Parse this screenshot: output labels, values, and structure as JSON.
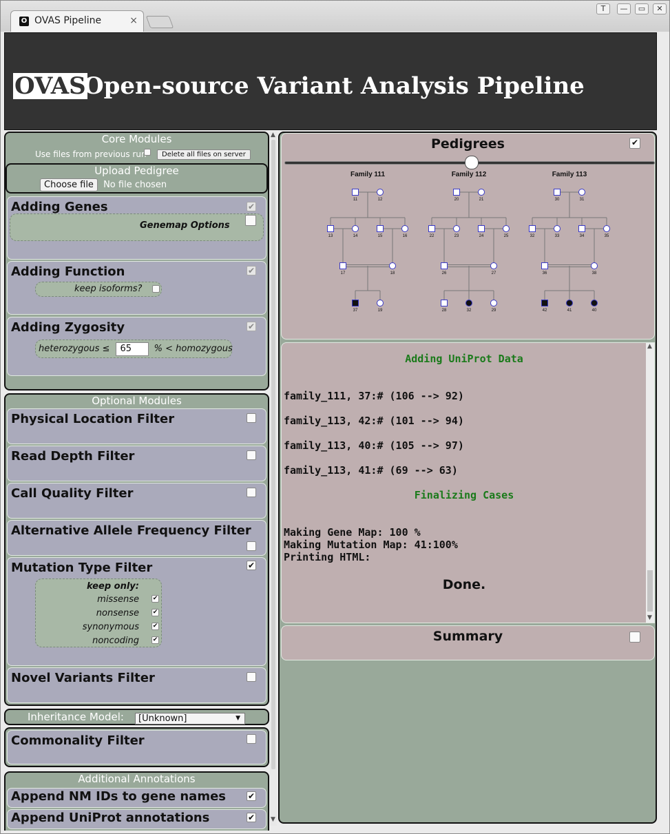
{
  "window": {
    "tab_title": "OVAS Pipeline",
    "tab_close": "×",
    "tab_icon_glyph": "O",
    "controls": [
      "T",
      "—",
      "▭",
      "✕"
    ]
  },
  "header": {
    "logo": "OVAS",
    "title": "Open-source Variant Analysis Pipeline"
  },
  "core": {
    "title": "Core Modules",
    "use_prev_label": "Use files from previous run",
    "delete_button": "Delete all files on server",
    "upload": {
      "title": "Upload Pedigree",
      "choose_button": "Choose file",
      "no_file": "No file chosen"
    },
    "adding_genes": {
      "title": "Adding Genes",
      "genemap_label": "Genemap Options"
    },
    "adding_function": {
      "title": "Adding Function",
      "isoforms_label": "keep isoforms?"
    },
    "adding_zygosity": {
      "title": "Adding Zygosity",
      "het_label": "heterozygous ≤",
      "het_value": "65",
      "hom_label": "% < homozygous"
    }
  },
  "optional": {
    "title": "Optional Modules",
    "physical_location": "Physical Location Filter",
    "read_depth": "Read Depth Filter",
    "call_quality": "Call Quality Filter",
    "alt_allele": "Alternative Allele Frequency Filter",
    "mutation_type": {
      "title": "Mutation Type Filter",
      "keep_only": "keep only:",
      "options": [
        "missense",
        "nonsense",
        "synonymous",
        "noncoding"
      ]
    },
    "novel_variants": "Novel Variants Filter"
  },
  "inheritance": {
    "label": "Inheritance Model:",
    "value": "[Unknown]"
  },
  "commonality": {
    "title": "Commonality Filter"
  },
  "additional": {
    "title": "Additional Annotations",
    "nm_ids": "Append NM IDs to gene names",
    "uniprot": "Append UniProt annotations"
  },
  "pedigrees": {
    "title": "Pedigrees",
    "families": [
      {
        "name": "Family 111",
        "ids": [
          "11",
          "12",
          "13",
          "14",
          "15",
          "16",
          "17",
          "18",
          "37",
          "19"
        ]
      },
      {
        "name": "Family 112",
        "ids": [
          "20",
          "21",
          "22",
          "23",
          "24",
          "25",
          "26",
          "27",
          "28",
          "32",
          "29"
        ]
      },
      {
        "name": "Family 113",
        "ids": [
          "30",
          "31",
          "32",
          "33",
          "34",
          "35",
          "36",
          "38",
          "42",
          "41",
          "40"
        ]
      }
    ]
  },
  "log": {
    "heading1": "Adding UniProt Data",
    "lines1": [
      "family_111, 37:# (106 --> 92)",
      "family_113, 42:# (101 --> 94)",
      "family_113, 40:# (105 --> 97)",
      "family_113, 41:# (69 --> 63)"
    ],
    "heading2": "Finalizing Cases",
    "lines2": [
      "Making Gene Map: 100 %",
      "Making Mutation Map: 41:100%",
      "Printing HTML:"
    ],
    "done": "Done."
  },
  "summary": {
    "title": "Summary"
  }
}
